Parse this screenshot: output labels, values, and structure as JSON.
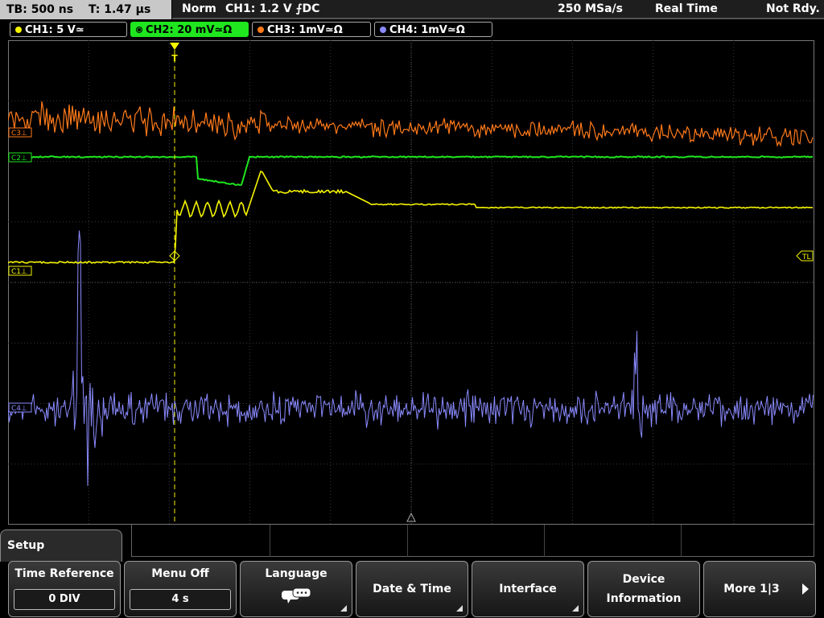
{
  "status": {
    "timebase": "TB: 500 ns",
    "trigger_time": "T: 1.47 µs",
    "trigger_mode": "Norm",
    "trigger_source": "CH1: 1.2 V ⨍DC",
    "sample_rate": "250 MSa/s",
    "acq_mode": "Real Time",
    "state": "Not Rdy."
  },
  "channels": [
    {
      "label": "CH1: 5 V≃",
      "color": "#f5f500",
      "active": false
    },
    {
      "label": "CH2: 20 mV≃Ω",
      "color": "#1fe61f",
      "active": true
    },
    {
      "label": "CH3: 1mV≃Ω",
      "color": "#ff7a1a",
      "active": false
    },
    {
      "label": "CH4: 1mV≃Ω",
      "color": "#8a8aff",
      "active": false
    }
  ],
  "markers": {
    "c3": "C3⊥",
    "c2": "C2⊥",
    "c1": "C1⊥",
    "c4": "C4⊥",
    "trigger_level": "TL",
    "trigger_pos": "T"
  },
  "menu": {
    "title": "Setup",
    "softkeys": [
      {
        "label": "Time Reference",
        "value": "0 DIV"
      },
      {
        "label": "Menu Off",
        "value": "4 s"
      },
      {
        "label": "Language",
        "icon": "speech-bubble-icon"
      },
      {
        "label": "Date & Time"
      },
      {
        "label": "Interface"
      },
      {
        "label_line1": "Device",
        "label_line2": "Information"
      },
      {
        "label": "More 1|3"
      }
    ]
  },
  "colors": {
    "ch1": "#f5f500",
    "ch2": "#1fe61f",
    "ch3": "#ff7a1a",
    "ch4": "#8a8aff",
    "grid": "#3a3a3a"
  }
}
